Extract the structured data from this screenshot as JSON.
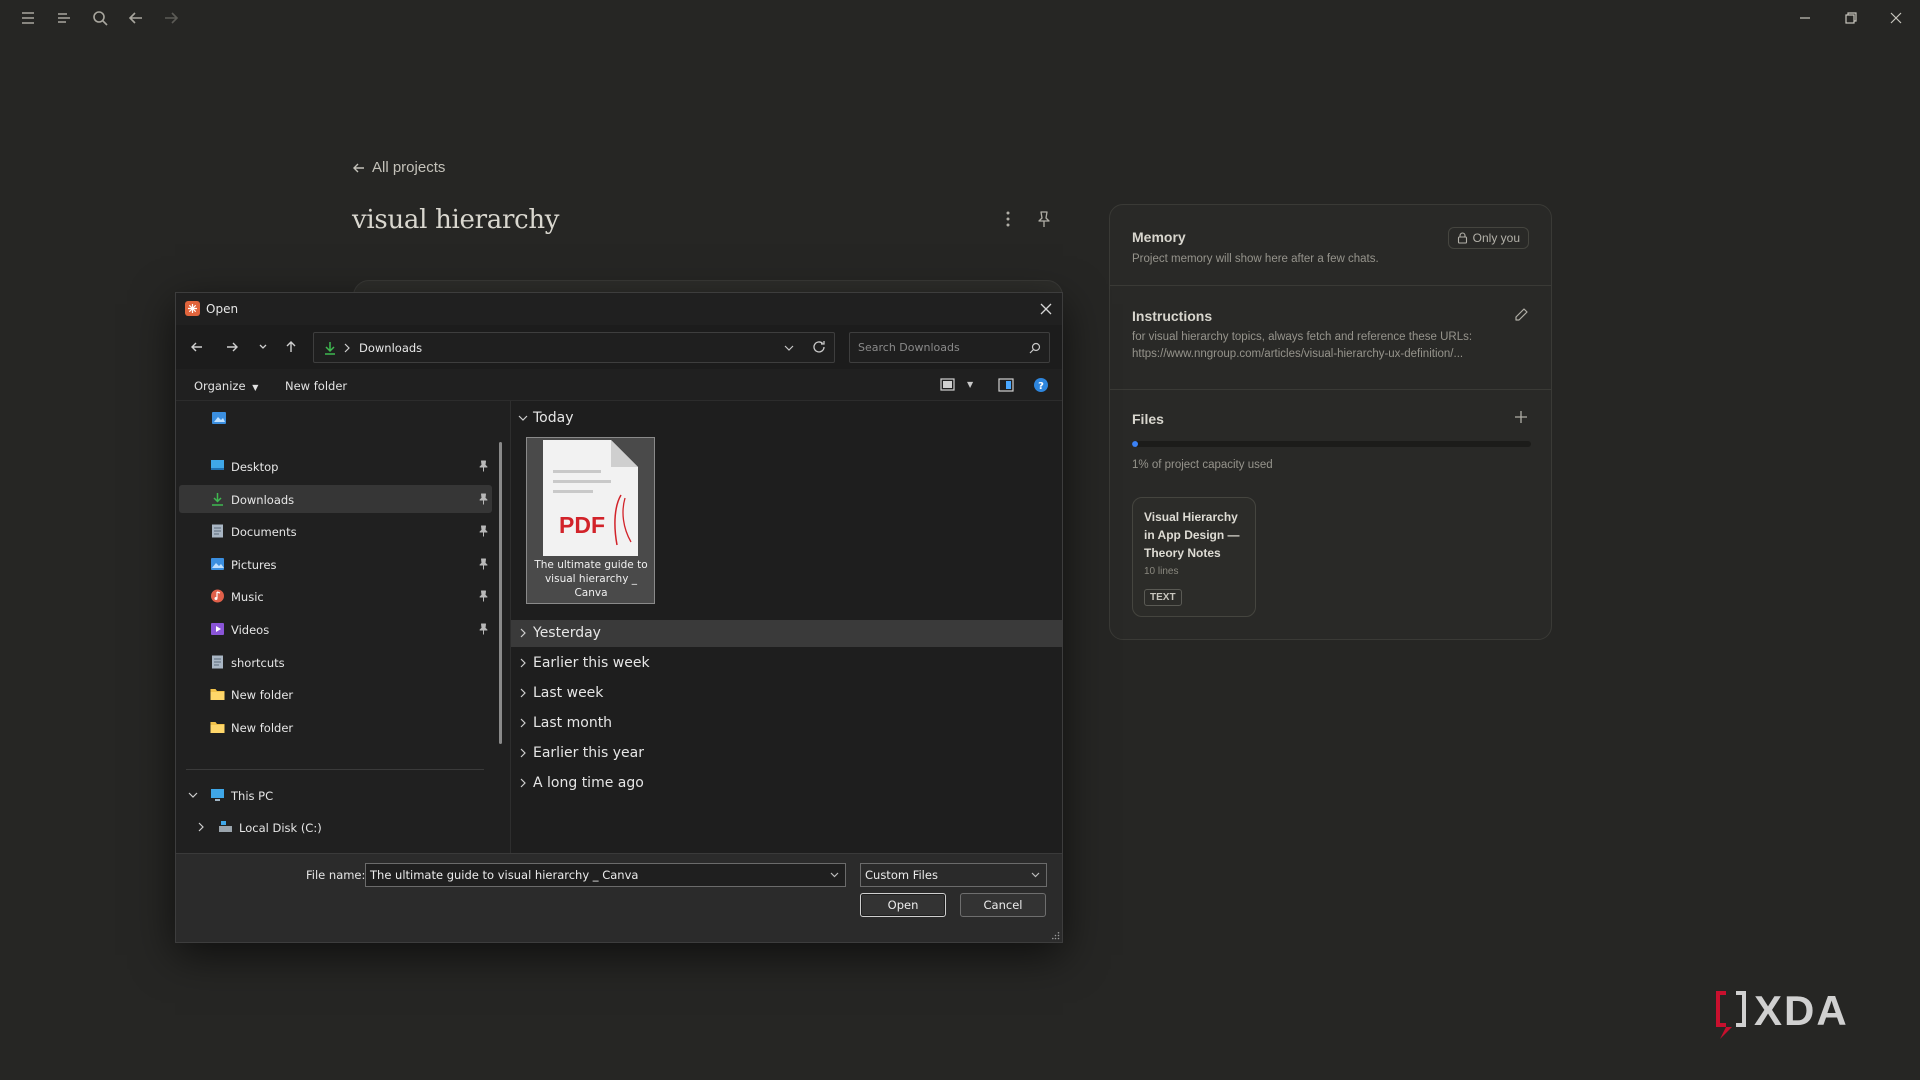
{
  "page": {
    "back_label": "All projects",
    "project_title": "visual hierarchy"
  },
  "panel": {
    "memory": {
      "title": "Memory",
      "visibility": "Only you",
      "description": "Project memory will show here after a few chats."
    },
    "instructions": {
      "title": "Instructions",
      "line1": "for visual hierarchy topics, always fetch and reference these URLs:",
      "line2": "https://www.nngroup.com/articles/visual-hierarchy-ux-definition/..."
    },
    "files": {
      "title": "Files",
      "capacity_used_fraction": 0.01,
      "capacity_text": "1% of project capacity used",
      "card": {
        "title": "Visual Hierarchy in App Design — Theory Notes",
        "lines": "10 lines",
        "badge": "TEXT"
      }
    }
  },
  "dialog": {
    "title": "Open",
    "address": "Downloads",
    "search_placeholder": "Search Downloads",
    "organize_label": "Organize",
    "new_folder_label": "New folder",
    "nav_items": [
      {
        "label": "Desktop",
        "icon": "desktop-icon",
        "pinned": true
      },
      {
        "label": "Downloads",
        "icon": "download-icon",
        "pinned": true,
        "selected": true
      },
      {
        "label": "Documents",
        "icon": "documents-icon",
        "pinned": true
      },
      {
        "label": "Pictures",
        "icon": "pictures-icon",
        "pinned": true
      },
      {
        "label": "Music",
        "icon": "music-icon",
        "pinned": true
      },
      {
        "label": "Videos",
        "icon": "videos-icon",
        "pinned": true
      },
      {
        "label": "shortcuts",
        "icon": "file-icon",
        "pinned": false
      },
      {
        "label": "New folder",
        "icon": "folder-icon",
        "pinned": false
      },
      {
        "label": "New folder",
        "icon": "folder-icon",
        "pinned": false
      }
    ],
    "this_pc_label": "This PC",
    "local_disk_label": "Local Disk (C:)",
    "groups": {
      "today": "Today",
      "yesterday": "Yesterday",
      "earlier_week": "Earlier this week",
      "last_week": "Last week",
      "last_month": "Last month",
      "earlier_year": "Earlier this year",
      "long_ago": "A long time ago"
    },
    "file": {
      "icon_text": "PDF",
      "name": "The ultimate guide to visual hierarchy _ Canva"
    },
    "file_name_label": "File name:",
    "file_name_value": "The ultimate guide to visual hierarchy _ Canva",
    "file_type": "Custom Files",
    "open_label": "Open",
    "cancel_label": "Cancel"
  },
  "watermark": "XDA",
  "colors": {
    "accent_blue": "#3b82f6",
    "background": "#262624",
    "pdf_red": "#d2232a"
  }
}
